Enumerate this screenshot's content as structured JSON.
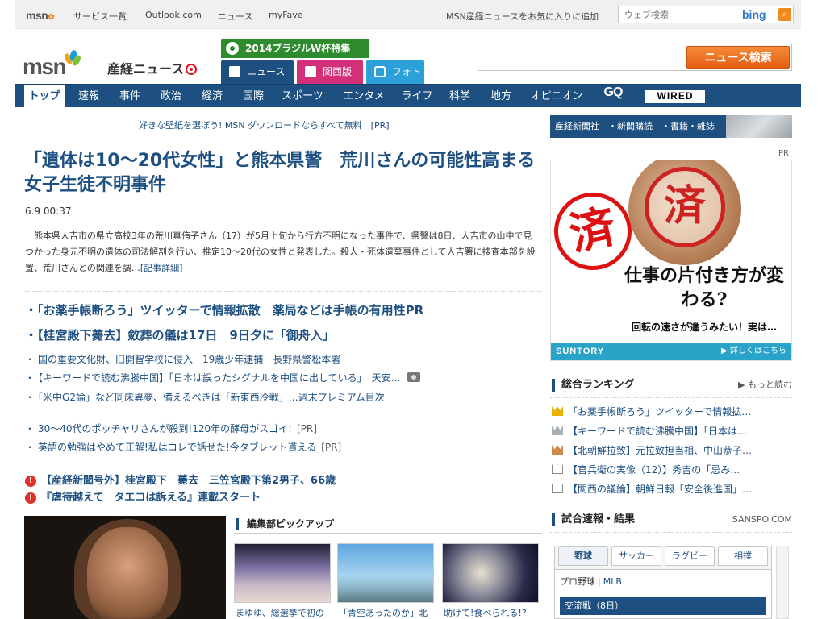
{
  "topbar": {
    "logo": "msn",
    "links": [
      "サービス一覧",
      "Outlook.com",
      "ニュース",
      "myFave"
    ],
    "fav": "MSN産経ニュースをお気に入りに追加",
    "search_placeholder": "ウェブ検索",
    "bing": "bing"
  },
  "header": {
    "logo_msn": "msn",
    "logo_sankei": "産経ニュース",
    "wc_tab": "2014ブラジルW杯特集",
    "tabs": [
      "ニュース",
      "関西版",
      "フォト"
    ],
    "news_search_button": "ニュース検索"
  },
  "nav": {
    "items": [
      "トップ",
      "速報",
      "事件",
      "政治",
      "経済",
      "国際",
      "スポーツ",
      "エンタメ",
      "ライフ",
      "科学",
      "地方",
      "オピニオン",
      "GQ",
      "WIRED"
    ]
  },
  "main": {
    "promo": "好きな壁紙を選ぼう! MSN ダウンロードならすべて無料　[PR]",
    "headline": "「遺体は10～20代女性」と熊本県警　荒川さんの可能性高まる　女子生徒不明事件",
    "date": "6.9 00:37",
    "lead": "熊本県人吉市の県立高校3年の荒川真侑子さん（17）が5月上旬から行方不明になった事件で、県警は8日、人吉市の山中で見つかった身元不明の遺体の司法解剖を行い、推定10～20代の女性と発表した。殺人・死体遺棄事件として人吉署に捜査本部を設置、荒川さんとの関連を調…",
    "lead_more": "[記事詳細]",
    "big_links": [
      "「お薬手帳断ろう」ツイッターで情報拡散　薬局などは手帳の有用性PR",
      "【桂宮殿下薨去】斂葬の儀は17日　9日夕に「御舟入」"
    ],
    "small_links": [
      "国の重要文化財、旧開智学校に侵入　19歳少年逮捕　長野県警松本署",
      "【キーワードで読む沸騰中国】「日本は誤ったシグナルを中国に出している」　天安…",
      "「米中G2論」など同床異夢、備えるべきは「新東西冷戦」…週末プレミアム目次"
    ],
    "pr_links": [
      {
        "text": "30～40代のポッチャリさんが殺到!120年の酵母がスゴイ!",
        "pr": "[PR]"
      },
      {
        "text": "英語の勉強はやめて正解!私はコレで話せた!今タブレット貰える",
        "pr": "[PR]"
      }
    ],
    "alert_links": [
      "【産経新聞号外】桂宮殿下　薨去　三笠宮殿下第2男子、66歳",
      "『虐待越えて　タエコは訴える』連載スタート"
    ],
    "pickup_title": "編集部ピックアップ",
    "pickup_captions": [
      "まゆゆ、総選挙で初の",
      "「青空あったのか」北",
      "助けて!食べられる!?"
    ]
  },
  "right": {
    "services": "産経新聞社　・新聞購読　・書籍・雑誌",
    "pr_label": "PR",
    "ad": {
      "stamp1": "済",
      "stamp2": "済",
      "copy1": "仕事の片付き方が変わる?",
      "copy2": "回転の速さが違うみたい！実は…",
      "brand": "SUNTORY",
      "detail": "詳しくはこちら"
    },
    "ranking_title": "総合ランキング",
    "ranking_more": "もっと読む",
    "ranking": [
      "「お薬手帳断ろう」ツイッターで情報拡…",
      "【キーワードで読む沸騰中国】「日本は…",
      "【北朝鮮拉致】元拉致担当相、中山恭子…",
      "【官兵衛の実像（12）】秀吉の「忌み…",
      "【関西の議論】朝鮮日報「安全後進国」…"
    ],
    "ranking_colors": [
      "#e8b400",
      "#a8b0b8",
      "#c98a4a",
      "#ffffff",
      "#ffffff"
    ],
    "score_title": "試合速報・結果",
    "score_source": "SANSPO.COM",
    "score_tabs": [
      "野球",
      "サッカー",
      "ラグビー",
      "相撲"
    ],
    "league": [
      "プロ野球",
      "MLB"
    ],
    "koryu": "交流戦（8日）"
  }
}
